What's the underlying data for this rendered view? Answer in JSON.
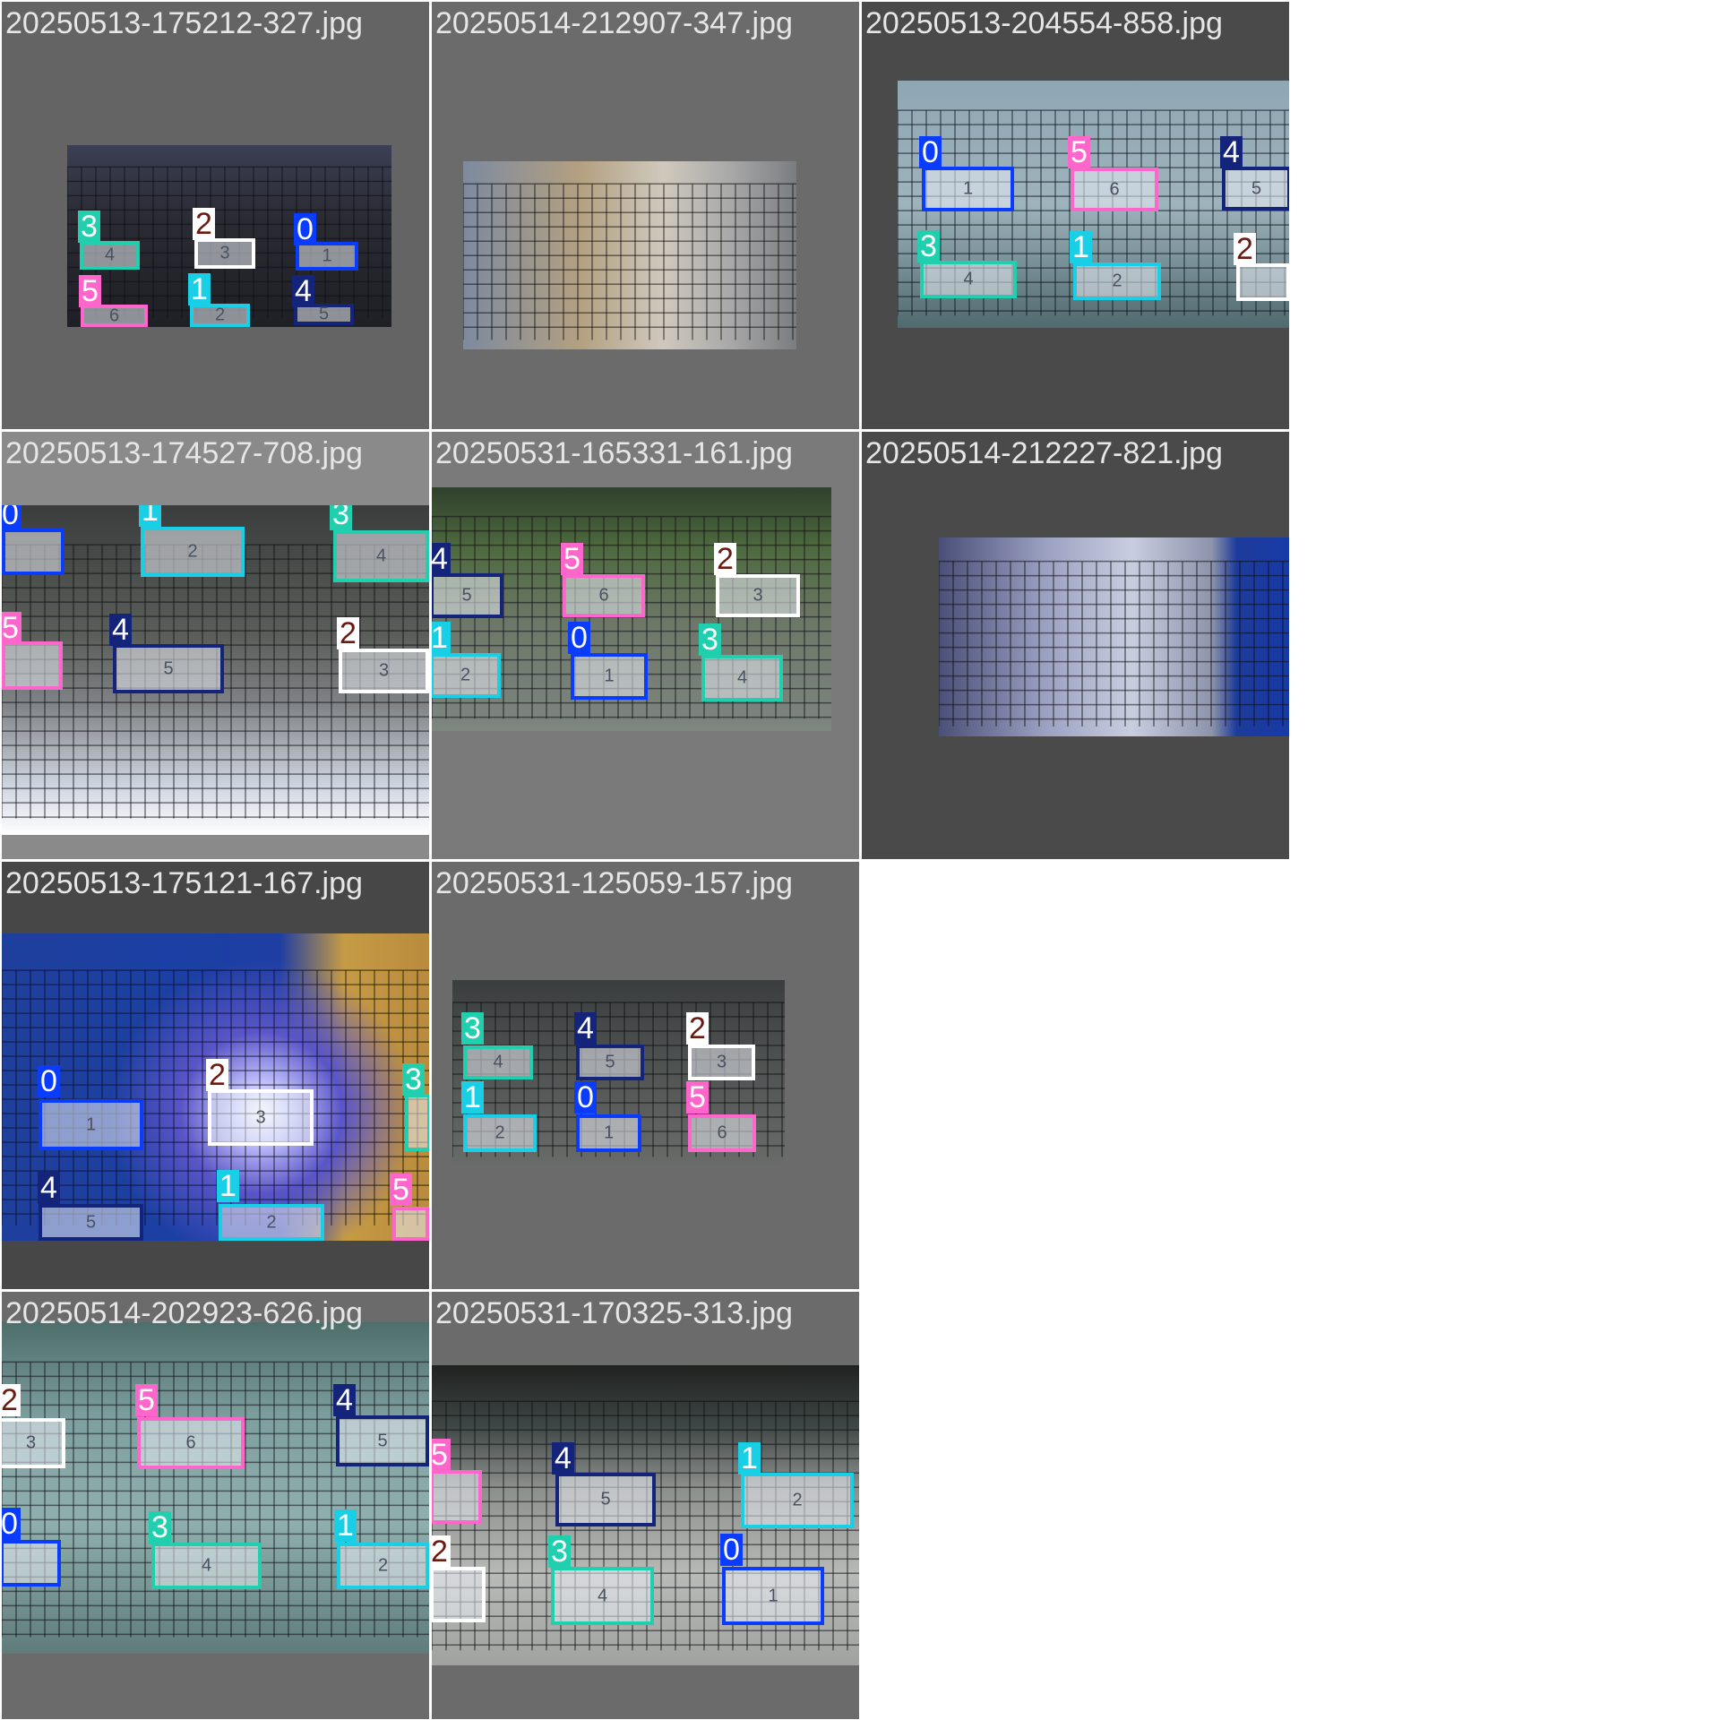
{
  "grid": {
    "tiles": [
      {
        "filename": "20250513-175212-327.jpg",
        "detections": [
          {
            "class_id": "3",
            "color": "#1fcfae",
            "digit": "4"
          },
          {
            "class_id": "2",
            "color": "#ffffff",
            "digit": "3"
          },
          {
            "class_id": "0",
            "color": "#0a3cff",
            "digit": "1"
          },
          {
            "class_id": "5",
            "color": "#ff66cc",
            "digit": "6"
          },
          {
            "class_id": "1",
            "color": "#19cfe6",
            "digit": "2"
          },
          {
            "class_id": "4",
            "color": "#14247a",
            "digit": "5"
          }
        ]
      },
      {
        "filename": "20250514-212907-347.jpg",
        "detections": []
      },
      {
        "filename": "20250513-204554-858.jpg",
        "detections": [
          {
            "class_id": "0",
            "color": "#0a3cff",
            "digit": "1"
          },
          {
            "class_id": "5",
            "color": "#ff66cc",
            "digit": "6"
          },
          {
            "class_id": "4",
            "color": "#14247a",
            "digit": "5"
          },
          {
            "class_id": "3",
            "color": "#1fcfae",
            "digit": "4"
          },
          {
            "class_id": "1",
            "color": "#19cfe6",
            "digit": "2"
          },
          {
            "class_id": "2",
            "color": "#ffffff",
            "digit": ""
          }
        ]
      },
      {
        "filename": "20250513-174527-708.jpg",
        "detections": [
          {
            "class_id": "0",
            "color": "#0a3cff",
            "digit": ""
          },
          {
            "class_id": "1",
            "color": "#19cfe6",
            "digit": "2"
          },
          {
            "class_id": "3",
            "color": "#1fcfae",
            "digit": "4"
          },
          {
            "class_id": "5",
            "color": "#ff66cc",
            "digit": ""
          },
          {
            "class_id": "4",
            "color": "#14247a",
            "digit": "5"
          },
          {
            "class_id": "2",
            "color": "#ffffff",
            "digit": "3"
          }
        ]
      },
      {
        "filename": "20250531-165331-161.jpg",
        "detections": [
          {
            "class_id": "4",
            "color": "#14247a",
            "digit": "5"
          },
          {
            "class_id": "5",
            "color": "#ff66cc",
            "digit": "6"
          },
          {
            "class_id": "2",
            "color": "#ffffff",
            "digit": "3"
          },
          {
            "class_id": "1",
            "color": "#19cfe6",
            "digit": "2"
          },
          {
            "class_id": "0",
            "color": "#0a3cff",
            "digit": "1"
          },
          {
            "class_id": "3",
            "color": "#1fcfae",
            "digit": "4"
          }
        ]
      },
      {
        "filename": "20250514-212227-821.jpg",
        "detections": []
      },
      {
        "filename": "20250513-175121-167.jpg",
        "detections": [
          {
            "class_id": "0",
            "color": "#0a3cff",
            "digit": "1"
          },
          {
            "class_id": "2",
            "color": "#ffffff",
            "digit": "3"
          },
          {
            "class_id": "3",
            "color": "#1fcfae",
            "digit": ""
          },
          {
            "class_id": "4",
            "color": "#14247a",
            "digit": "5"
          },
          {
            "class_id": "1",
            "color": "#19cfe6",
            "digit": "2"
          },
          {
            "class_id": "5",
            "color": "#ff66cc",
            "digit": ""
          }
        ]
      },
      {
        "filename": "20250531-125059-157.jpg",
        "detections": [
          {
            "class_id": "3",
            "color": "#1fcfae",
            "digit": "4"
          },
          {
            "class_id": "4",
            "color": "#14247a",
            "digit": "5"
          },
          {
            "class_id": "2",
            "color": "#ffffff",
            "digit": "3"
          },
          {
            "class_id": "1",
            "color": "#19cfe6",
            "digit": "2"
          },
          {
            "class_id": "0",
            "color": "#0a3cff",
            "digit": "1"
          },
          {
            "class_id": "5",
            "color": "#ff66cc",
            "digit": "6"
          }
        ]
      },
      {
        "filename": "20250514-202923-626.jpg",
        "detections": [
          {
            "class_id": "2",
            "color": "#ffffff",
            "digit": "3"
          },
          {
            "class_id": "5",
            "color": "#ff66cc",
            "digit": "6"
          },
          {
            "class_id": "4",
            "color": "#14247a",
            "digit": "5"
          },
          {
            "class_id": "0",
            "color": "#0a3cff",
            "digit": ""
          },
          {
            "class_id": "3",
            "color": "#1fcfae",
            "digit": "4"
          },
          {
            "class_id": "1",
            "color": "#19cfe6",
            "digit": "2"
          }
        ]
      },
      {
        "filename": "20250531-170325-313.jpg",
        "detections": [
          {
            "class_id": "5",
            "color": "#ff66cc",
            "digit": ""
          },
          {
            "class_id": "4",
            "color": "#14247a",
            "digit": "5"
          },
          {
            "class_id": "1",
            "color": "#19cfe6",
            "digit": "2"
          },
          {
            "class_id": "2",
            "color": "#ffffff",
            "digit": ""
          },
          {
            "class_id": "3",
            "color": "#1fcfae",
            "digit": "4"
          },
          {
            "class_id": "0",
            "color": "#0a3cff",
            "digit": "1"
          }
        ]
      }
    ]
  }
}
